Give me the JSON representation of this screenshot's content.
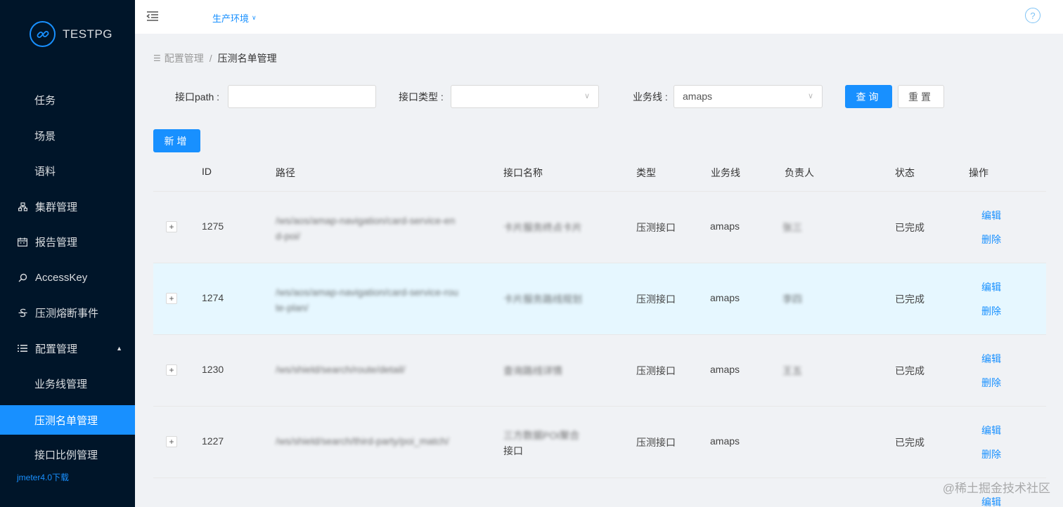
{
  "app": {
    "name": "TESTPG",
    "env": "生产环境"
  },
  "sidebar": {
    "items": [
      {
        "label": "任务"
      },
      {
        "label": "场景"
      },
      {
        "label": "语料"
      },
      {
        "label": "集群管理"
      },
      {
        "label": "报告管理"
      },
      {
        "label": "AccessKey"
      },
      {
        "label": "压测熔断事件"
      },
      {
        "label": "配置管理"
      },
      {
        "label": "业务线管理"
      },
      {
        "label": "压测名单管理"
      },
      {
        "label": "接口比例管理"
      }
    ],
    "footer_link": "jmeter4.0下载"
  },
  "breadcrumb": {
    "parent": "配置管理",
    "separator": "/",
    "current": "压测名单管理"
  },
  "filters": {
    "path_label": "接口path :",
    "path_value": "",
    "type_label": "接口类型 :",
    "type_value": "",
    "biz_label": "业务线 :",
    "biz_value": "amaps",
    "search_button": "查询",
    "reset_button": "重置",
    "add_button": "新增"
  },
  "table": {
    "columns": [
      "ID",
      "路径",
      "接口名称",
      "类型",
      "业务线",
      "负责人",
      "状态",
      "操作"
    ],
    "rows": [
      {
        "id": "1275",
        "path": [
          "/ws/aos/amap-navigation/card-service-en",
          "d-poi/"
        ],
        "name": [
          "卡片服务终点卡片"
        ],
        "type": "压测接口",
        "biz": "amaps",
        "owner": "张三",
        "status": "已完成",
        "edit": "编辑",
        "delete": "删除"
      },
      {
        "id": "1274",
        "path": [
          "/ws/aos/amap-navigation/card-service-rou",
          "te-plan/"
        ],
        "name": [
          "卡片服务路线规划"
        ],
        "type": "压测接口",
        "biz": "amaps",
        "owner": "李四",
        "status": "已完成",
        "edit": "编辑",
        "delete": "删除"
      },
      {
        "id": "1230",
        "path": [
          "/ws/shield/search/route/detail/"
        ],
        "name": [
          "查询路线详情"
        ],
        "type": "压测接口",
        "biz": "amaps",
        "owner": "王五",
        "status": "已完成",
        "edit": "编辑",
        "delete": "删除"
      },
      {
        "id": "1227",
        "path": [
          "/ws/shield/search/third-party/poi_match/"
        ],
        "name": [
          "三方数据POI聚合",
          "接口"
        ],
        "type": "压测接口",
        "biz": "amaps",
        "owner": "",
        "status": "已完成",
        "edit": "编辑",
        "delete": "删除"
      }
    ],
    "extra_edit": "编辑"
  },
  "watermark": "@稀土掘金技术社区"
}
